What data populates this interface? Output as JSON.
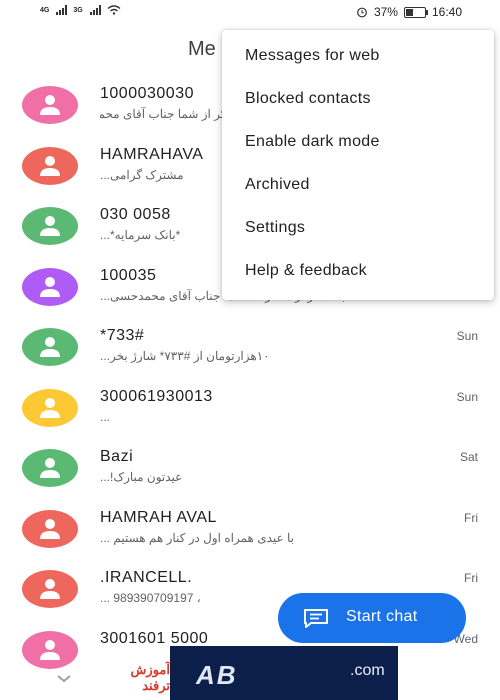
{
  "status_bar": {
    "sim1": "4G",
    "sim2": "3G",
    "battery_text": "37%",
    "battery_level": 0.37,
    "time": "16:40"
  },
  "app_title": "Me",
  "menu": {
    "items": [
      "Messages for web",
      "Blocked contacts",
      "Enable dark mode",
      "Archived",
      "Settings",
      "Help & feedback"
    ]
  },
  "conversations": [
    {
      "name": "1000030030",
      "snippet": "مشترک محترم با سلام و تبریک، ضمن تشکر از شما جناب آقای محمدحسینی کرمی گرامی...",
      "time": "",
      "color": "#f06fa6"
    },
    {
      "name": "HAMRAHAVA",
      "snippet": "مشترک گرامی...",
      "time": "",
      "color": "#ee675c"
    },
    {
      "name": "030 0058",
      "snippet": "*بانک سرمایه*...",
      "time": "",
      "color": "#5bb974"
    },
    {
      "name": "100035",
      "snippet": "با تشکر از مشارکت شما جناب آقای محمدحسی...",
      "time": "",
      "color": "#af5cf7"
    },
    {
      "name": "*733#",
      "snippet": "۱۰هزارتومان از #۷۳۳* شارژ بخر...",
      "time": "Sun",
      "color": "#5bb974"
    },
    {
      "name": "300061930013",
      "snippet": "...",
      "time": "Sun",
      "color": "#fcc934"
    },
    {
      "name": "Bazi",
      "snippet": "عیدتون مبارک!...",
      "time": "Sat",
      "color": "#5bb974"
    },
    {
      "name": "HAMRAH AVAL",
      "snippet": "با عیدی همراه اول در کنار هم هستیم ...",
      "time": "Fri",
      "color": "#ee675c"
    },
    {
      "name": ".IRANCELL.",
      "snippet": "، 989390709197 ...",
      "time": "Fri",
      "color": "#ee675c"
    },
    {
      "name": "3001601 5000",
      "snippet": "",
      "time": "Wed",
      "color": "#f06fa6"
    }
  ],
  "fab": {
    "label": "Start chat"
  },
  "watermark": {
    "left_text": "آموزش ترفند",
    "center_text": "AB",
    "suffix": ".com"
  }
}
